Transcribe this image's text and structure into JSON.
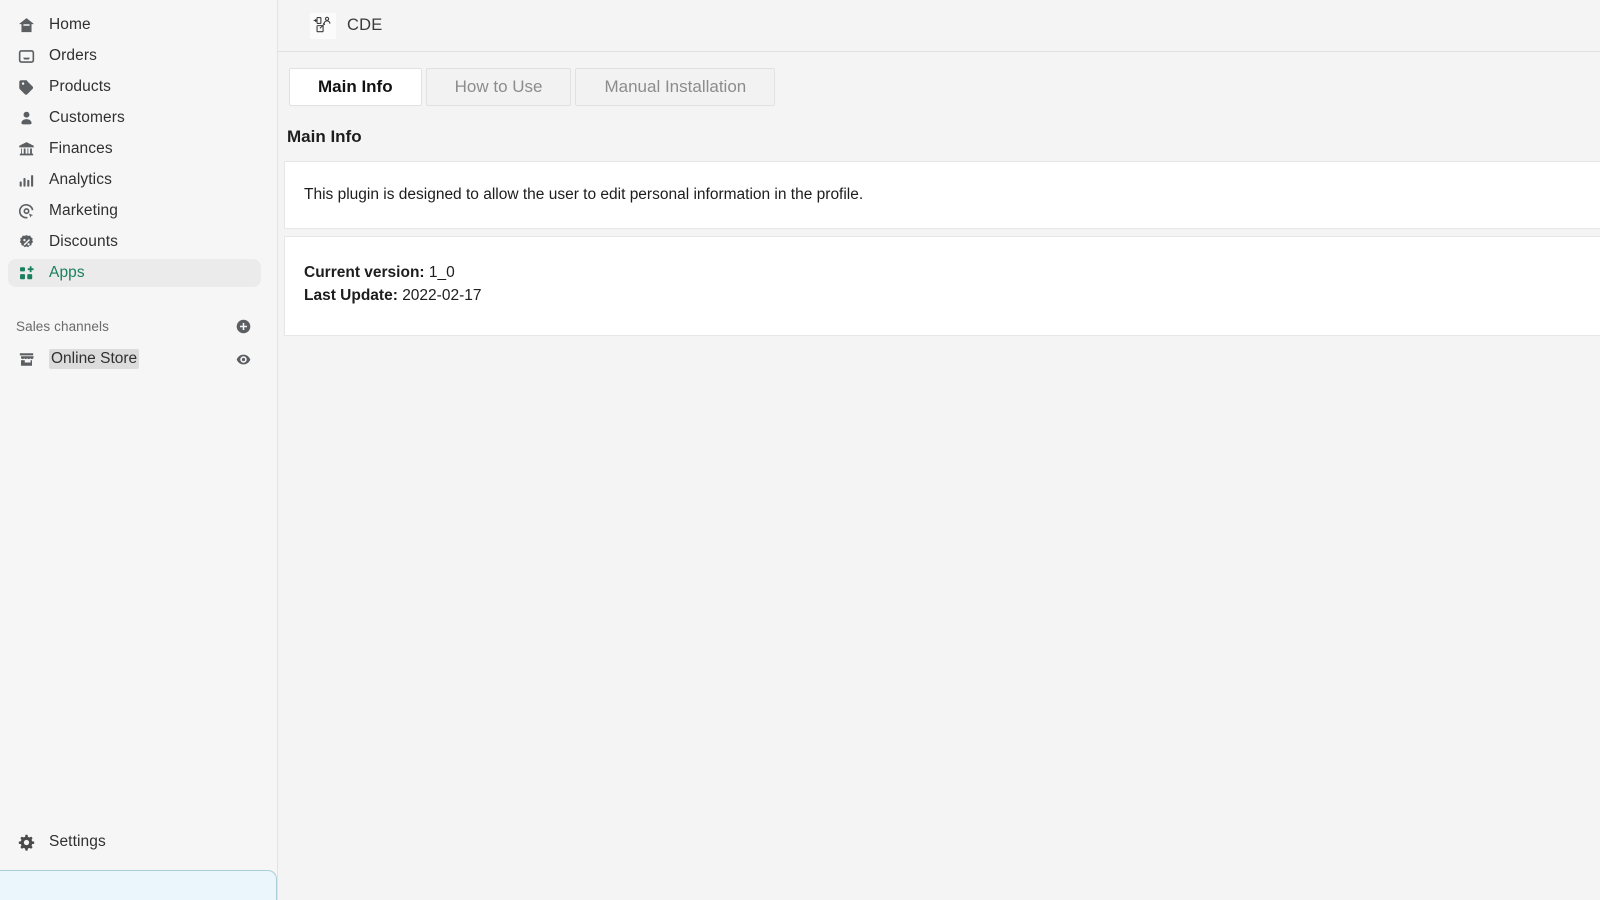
{
  "sidebar": {
    "nav_items": [
      {
        "label": "Home",
        "icon": "home-icon",
        "active": false
      },
      {
        "label": "Orders",
        "icon": "orders-icon",
        "active": false
      },
      {
        "label": "Products",
        "icon": "products-tag-icon",
        "active": false
      },
      {
        "label": "Customers",
        "icon": "customers-person-icon",
        "active": false
      },
      {
        "label": "Finances",
        "icon": "finances-bank-icon",
        "active": false
      },
      {
        "label": "Analytics",
        "icon": "analytics-bars-icon",
        "active": false
      },
      {
        "label": "Marketing",
        "icon": "marketing-target-icon",
        "active": false
      },
      {
        "label": "Discounts",
        "icon": "discounts-percent-icon",
        "active": false
      },
      {
        "label": "Apps",
        "icon": "apps-grid-plus-icon",
        "active": true
      }
    ],
    "channels": {
      "heading": "Sales channels",
      "add_icon": "circle-plus-icon",
      "items": [
        {
          "label": "Online Store",
          "icon": "storefront-icon",
          "action_icon": "eye-icon"
        }
      ]
    },
    "settings": {
      "label": "Settings",
      "icon": "gear-icon"
    },
    "active_accent_color": "#1a7f5c"
  },
  "topbar": {
    "app_title": "CDE",
    "app_logo_icon": "plugin-edit-profile-icon"
  },
  "main": {
    "tabs": [
      {
        "label": "Main Info",
        "active": true
      },
      {
        "label": "How to Use",
        "active": false
      },
      {
        "label": "Manual Installation",
        "active": false
      }
    ],
    "section_title": "Main Info",
    "description_card": {
      "text": "This plugin is designed to allow the user to edit personal information in the profile."
    },
    "version_card": {
      "current_version_label": "Current version:",
      "current_version_value": "1_0",
      "last_update_label": "Last Update:",
      "last_update_value": "2022-02-17"
    }
  }
}
